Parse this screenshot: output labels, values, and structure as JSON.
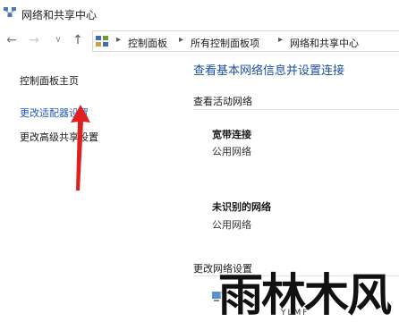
{
  "window": {
    "title": "网络和共享中心",
    "icon": "network-center-icon"
  },
  "nav": {
    "back_glyph": "←",
    "forward_glyph": "→",
    "recent_glyph": "∨",
    "up_glyph": "↑"
  },
  "address": {
    "icon": "control-panel-icon",
    "separator": "▸",
    "crumbs": [
      "控制面板",
      "所有控制面板项",
      "网络和共享中心"
    ]
  },
  "sidebar": {
    "items": [
      {
        "label": "控制面板主页"
      },
      {
        "label": "更改适配器设置",
        "highlighted": true
      },
      {
        "label": "更改高级共享设置"
      }
    ]
  },
  "main": {
    "heading": "查看基本网络信息并设置连接",
    "active_section": "查看活动网络",
    "networks": [
      {
        "name": "宽带连接",
        "type": "公用网络"
      },
      {
        "name": "未识别的网络",
        "type": "公用网络"
      }
    ],
    "change_section": "更改网络设置"
  },
  "watermark": {
    "text": "雨林木风",
    "subtext": "YLMF"
  },
  "colors": {
    "link": "#1e5bbd",
    "heading": "#1c4f9c",
    "arrow": "#e0201e"
  }
}
